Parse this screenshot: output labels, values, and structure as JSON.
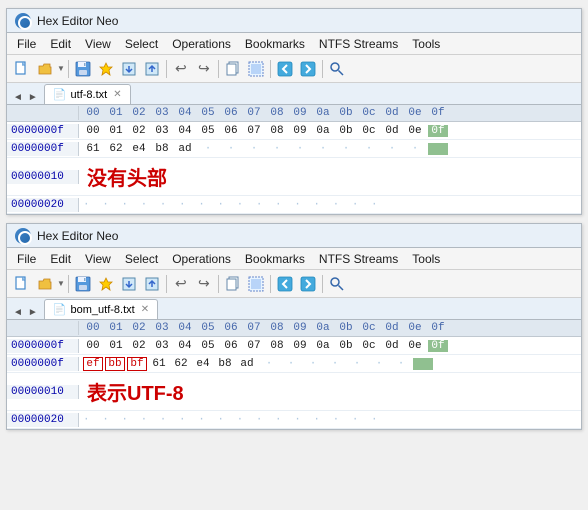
{
  "panels": [
    {
      "id": "panel1",
      "title": "Hex Editor Neo",
      "menu": [
        "File",
        "Edit",
        "View",
        "Select",
        "Operations",
        "Bookmarks",
        "NTFS Streams",
        "Tools"
      ],
      "tab": {
        "filename": "utf-8.txt",
        "icon": "📄"
      },
      "hex_header": [
        "",
        "00",
        "01",
        "02",
        "03",
        "04",
        "05",
        "06",
        "07",
        "08",
        "09",
        "0a",
        "0b",
        "0c",
        "0d",
        "0e",
        "0f"
      ],
      "rows": [
        {
          "addr": "0000000f",
          "cells": [
            "00",
            "01",
            "02",
            "03",
            "04",
            "05",
            "06",
            "07",
            "08",
            "09",
            "0a",
            "0b",
            "0c",
            "0d",
            "0e",
            "0f"
          ],
          "type": "header_data"
        },
        {
          "addr": "0000000f",
          "cells": [
            "61",
            "62",
            "e4",
            "b8",
            "ad"
          ],
          "type": "data",
          "green_cell": true
        },
        {
          "addr": "00000010",
          "type": "chinese",
          "text": "没有头部"
        },
        {
          "addr": "00000020",
          "type": "dots"
        }
      ]
    },
    {
      "id": "panel2",
      "title": "Hex Editor Neo",
      "menu": [
        "File",
        "Edit",
        "View",
        "Select",
        "Operations",
        "Bookmarks",
        "NTFS Streams",
        "Tools"
      ],
      "tab": {
        "filename": "bom_utf-8.txt",
        "icon": "📄"
      },
      "hex_header": [
        "",
        "00",
        "01",
        "02",
        "03",
        "04",
        "05",
        "06",
        "07",
        "08",
        "09",
        "0a",
        "0b",
        "0c",
        "0d",
        "0e",
        "0f"
      ],
      "rows": [
        {
          "addr": "0000000f",
          "cells": [
            "00",
            "01",
            "02",
            "03",
            "04",
            "05",
            "06",
            "07",
            "08",
            "09",
            "0a",
            "0b",
            "0c",
            "0d",
            "0e",
            "0f"
          ],
          "type": "header_data"
        },
        {
          "addr": "0000000f",
          "cells_boxed": [
            "ef",
            "bb",
            "bf"
          ],
          "cells_normal": [
            "61",
            "62",
            "e4",
            "b8",
            "ad"
          ],
          "type": "data_boxed",
          "green_cell": true
        },
        {
          "addr": "00000010",
          "type": "chinese",
          "text": "表示UTF-8"
        },
        {
          "addr": "00000020",
          "type": "dots"
        }
      ]
    }
  ]
}
